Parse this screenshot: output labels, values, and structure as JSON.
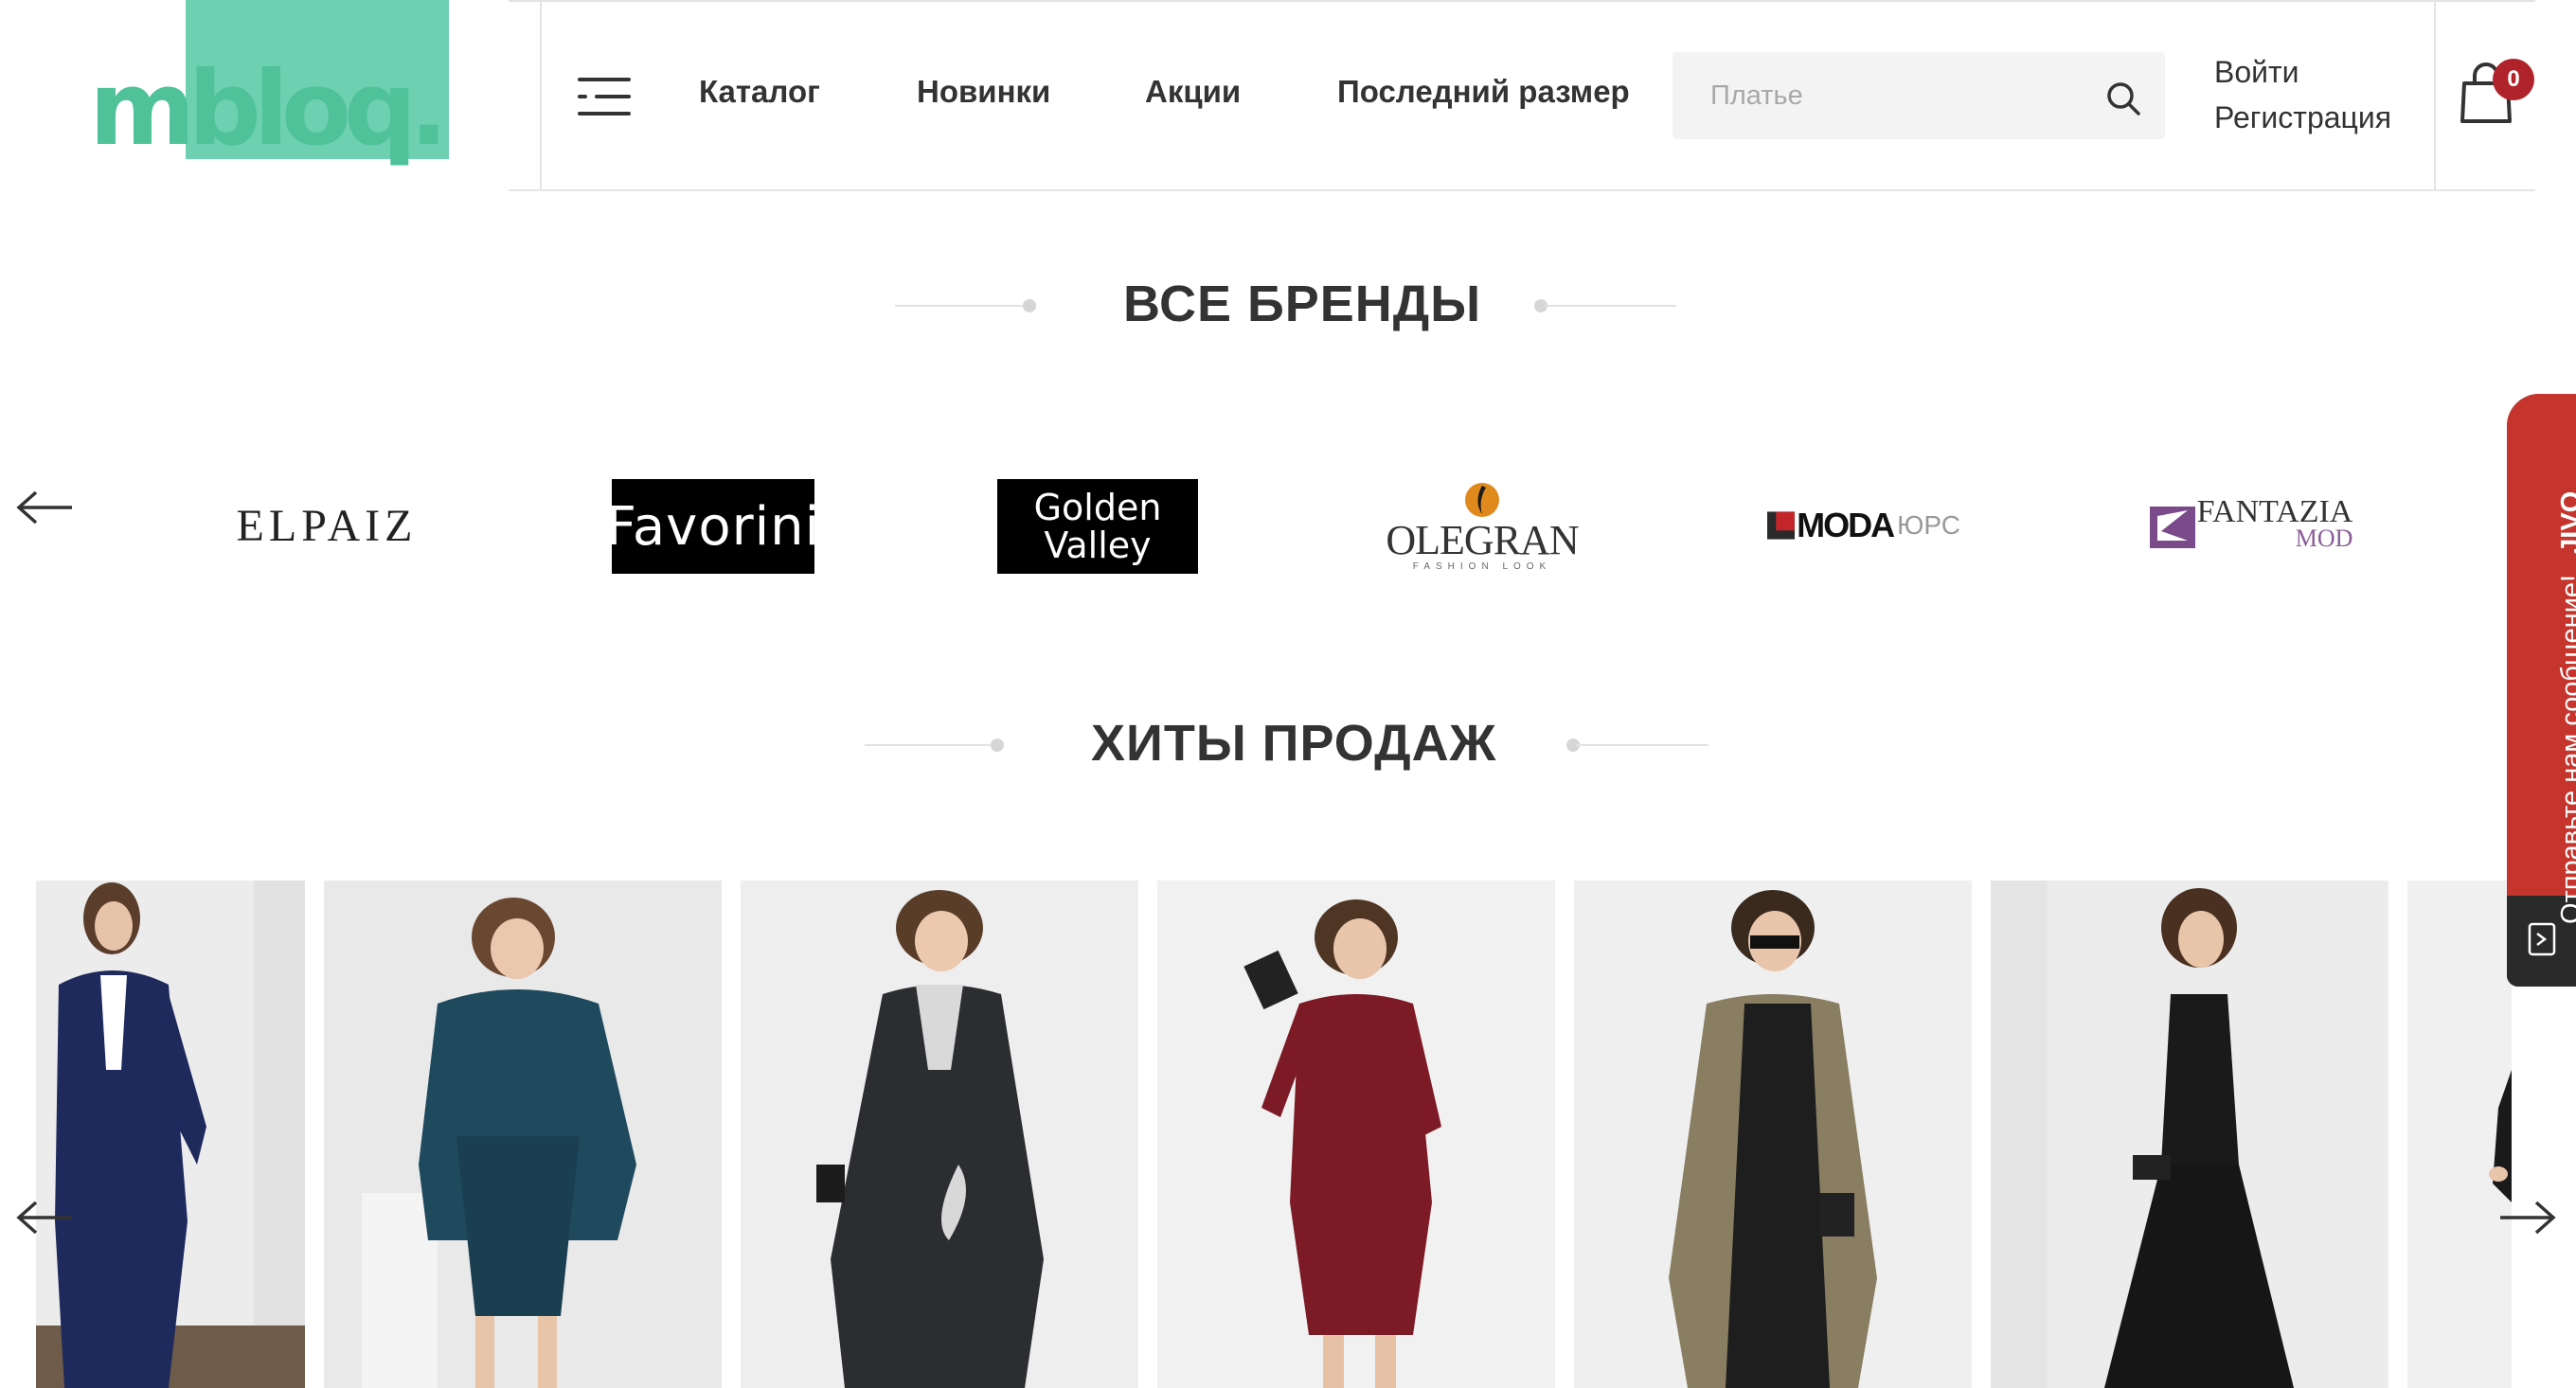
{
  "header": {
    "logo_text": "mbloq.",
    "nav": [
      {
        "label": "Каталог"
      },
      {
        "label": "Новинки"
      },
      {
        "label": "Акции"
      },
      {
        "label": "Последний размер"
      }
    ],
    "search": {
      "placeholder": "Платье",
      "value": ""
    },
    "login_label": "Войти",
    "register_label": "Регистрация",
    "cart_count": "0"
  },
  "brands_section": {
    "title": "ВСЕ БРЕНДЫ",
    "brands": [
      {
        "name": "ELPAIZ"
      },
      {
        "name": "Favorini"
      },
      {
        "name_line1": "Golden",
        "name_line2": "Valley"
      },
      {
        "name": "OLEGRAN",
        "tagline": "FASHION LOOK"
      },
      {
        "name": "MODA",
        "suffix": "ЮРС"
      },
      {
        "name": "FANTAZIA",
        "suffix": "MOD"
      }
    ]
  },
  "bestsellers_section": {
    "title": "ХИТЫ ПРОДАЖ",
    "products": [
      {
        "garment": "navy trouser suit with white blouse",
        "color": "#1f2a5c"
      },
      {
        "garment": "teal dress with cape overlay",
        "color": "#1f4a5e"
      },
      {
        "garment": "black shift dress with white print",
        "color": "#2b2d31"
      },
      {
        "garment": "burgundy wrap knit dress",
        "color": "#7c1a26"
      },
      {
        "garment": "black and leopard print dress",
        "color": "#1e1e1e"
      },
      {
        "garment": "black tiered sleeveless maxi dress",
        "color": "#161616"
      }
    ]
  },
  "chat_widget": {
    "label": "Отправьте нам сообщение!",
    "brand": "JIVO"
  },
  "colors": {
    "accent": "#5fcca6",
    "badge": "#b0232a",
    "chat": "#c6352d",
    "text": "#333333"
  }
}
